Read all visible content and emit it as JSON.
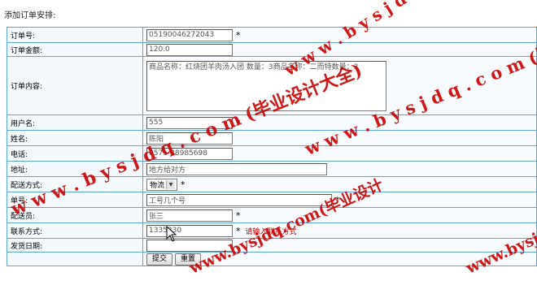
{
  "page": {
    "heading": "添加订单安排:"
  },
  "form": {
    "order_no": {
      "label": "订单号:",
      "value": "05190046272043",
      "required": "*"
    },
    "amount": {
      "label": "订单金额:",
      "value": "120.0"
    },
    "content": {
      "label": "订单内容:",
      "value": "商品名称：红烧团羊肉汤入团 数量：3商品名称：二而特数量：3"
    },
    "username": {
      "label": "用户名:",
      "value": "555",
      "required": "*"
    },
    "name": {
      "label": "姓名:",
      "value": "陈阳"
    },
    "phone": {
      "label": "电话:",
      "value": "0571-88985698"
    },
    "address": {
      "label": "地址:",
      "value": "地方给对方"
    },
    "delivery_method": {
      "label": "配送方式:",
      "selected": "物流",
      "required": "*"
    },
    "tracking_no": {
      "label": "单号:",
      "value": "工号几个号",
      "required": "*"
    },
    "courier": {
      "label": "配送员:",
      "value": "张三",
      "required": "*"
    },
    "contact": {
      "label": "联系方式:",
      "value": "1335330",
      "required": "*",
      "hint": "请输入联系方式"
    },
    "ship_date": {
      "label": "发货日期:",
      "value": ""
    },
    "buttons": {
      "submit": "提交",
      "reset": "重置"
    }
  },
  "watermark": {
    "text1": "w w w . b y s j d q . c o m (毕业设计大全)",
    "text2": "www.bysjdq.com(毕业设计"
  }
}
